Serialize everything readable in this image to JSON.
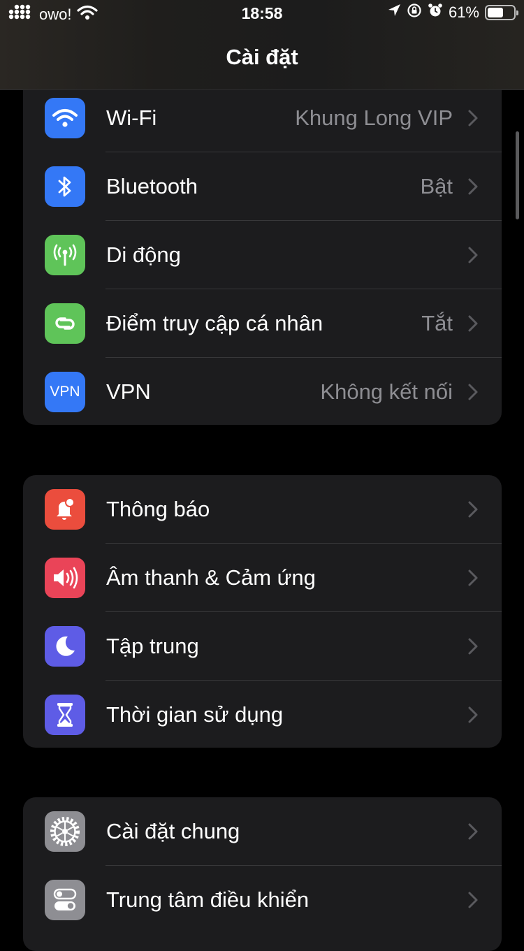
{
  "status_bar": {
    "carrier": "owo!",
    "time": "18:58",
    "battery_percent_text": "61%",
    "battery_level": 0.61
  },
  "nav": {
    "title": "Cài đặt"
  },
  "groups": [
    {
      "items": [
        {
          "label": "Wi-Fi",
          "value": "Khung Long VIP",
          "icon": "wifi-icon",
          "color": "#3478f6"
        },
        {
          "label": "Bluetooth",
          "value": "Bật",
          "icon": "bluetooth-icon",
          "color": "#3478f6"
        },
        {
          "label": "Di động",
          "value": "",
          "icon": "antenna-icon",
          "color": "#5fc459"
        },
        {
          "label": "Điểm truy cập cá nhân",
          "value": "Tắt",
          "icon": "hotspot-icon",
          "color": "#5fc459"
        },
        {
          "label": "VPN",
          "value": "Không kết nối",
          "icon": "vpn-icon",
          "icon_text": "VPN",
          "color": "#3478f6"
        }
      ]
    },
    {
      "items": [
        {
          "label": "Thông báo",
          "value": "",
          "icon": "bell-icon",
          "color": "#eb4d3d"
        },
        {
          "label": "Âm thanh & Cảm ứng",
          "value": "",
          "icon": "speaker-icon",
          "color": "#ea4458"
        },
        {
          "label": "Tập trung",
          "value": "",
          "icon": "moon-icon",
          "color": "#5e5ce6"
        },
        {
          "label": "Thời gian sử dụng",
          "value": "",
          "icon": "hourglass-icon",
          "color": "#5e5ce6"
        }
      ]
    },
    {
      "items": [
        {
          "label": "Cài đặt chung",
          "value": "",
          "icon": "gear-icon",
          "color": "#8e8e93"
        },
        {
          "label": "Trung tâm điều khiển",
          "value": "",
          "icon": "toggles-icon",
          "color": "#8e8e93"
        }
      ]
    }
  ]
}
